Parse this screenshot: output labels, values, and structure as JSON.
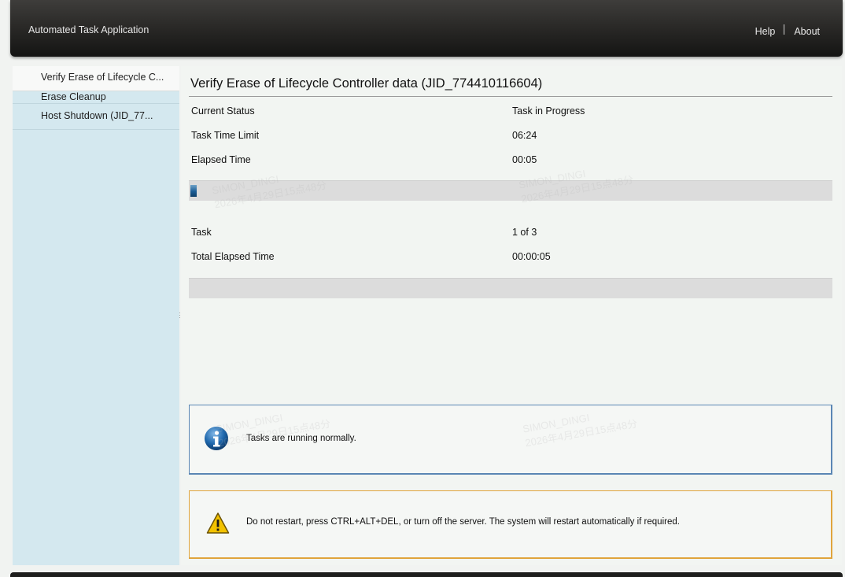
{
  "header": {
    "app_title": "Automated Task Application",
    "help_label": "Help",
    "about_label": "About"
  },
  "sidebar": {
    "items": [
      {
        "label": "Verify Erase of Lifecycle C..."
      },
      {
        "label": "Erase Cleanup"
      },
      {
        "label": "Host Shutdown (JID_77..."
      }
    ]
  },
  "main": {
    "title": "Verify Erase of Lifecycle Controller data (JID_774410116604)",
    "status_rows": [
      {
        "label": "Current Status",
        "value": "Task in Progress"
      },
      {
        "label": "Task Time Limit",
        "value": "06:24"
      },
      {
        "label": "Elapsed Time",
        "value": "00:05"
      }
    ],
    "task_progress": 0.01,
    "summary_rows": [
      {
        "label": "Task",
        "value": "1 of 3"
      },
      {
        "label": "Total Elapsed Time",
        "value": "00:00:05"
      }
    ],
    "overall_progress": 0,
    "info_message": "Tasks are running normally.",
    "warning_message": "Do not restart, press CTRL+ALT+DEL, or turn off the server.  The system will restart automatically if required."
  },
  "colors": {
    "sidebar_bg": "#d4e8ef",
    "info_border": "#5a86b4",
    "warning_border": "#e0a43c",
    "progress_fill": "#1b5d95"
  },
  "watermark": {
    "name": "SIMON_DINGI",
    "datetime": "2026年4月29日15点48分"
  }
}
